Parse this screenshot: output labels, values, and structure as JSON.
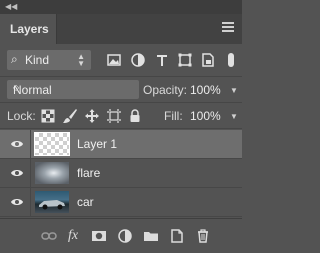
{
  "panel": {
    "tab_label": "Layers"
  },
  "filter": {
    "kind_label": "Kind",
    "icons": [
      "pixel-filter-icon",
      "adjustment-filter-icon",
      "type-filter-icon",
      "shape-filter-icon",
      "smart-object-filter-icon"
    ]
  },
  "blend": {
    "mode": "Normal",
    "opacity_label": "Opacity:",
    "opacity_value": "100%"
  },
  "lock": {
    "label": "Lock:",
    "fill_label": "Fill:",
    "fill_value": "100%"
  },
  "layers": [
    {
      "name": "Layer 1",
      "selected": true,
      "visible": true
    },
    {
      "name": "flare",
      "selected": false,
      "visible": true
    },
    {
      "name": "car",
      "selected": false,
      "visible": true
    }
  ],
  "footer": {
    "fx_label": "fx"
  }
}
